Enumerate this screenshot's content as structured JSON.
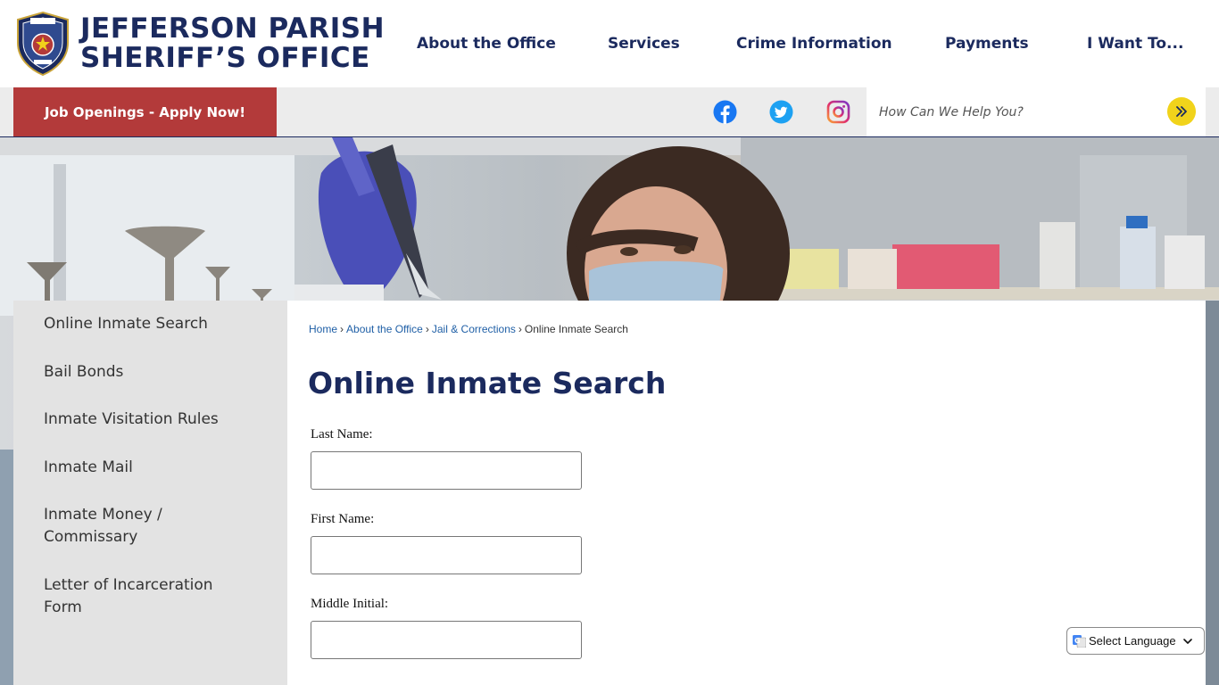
{
  "header": {
    "logo_line1": "JEFFERSON PARISH",
    "logo_line2": "SHERIFF’S OFFICE",
    "badge_icon": "sheriff-badge",
    "nav": [
      "About the Office",
      "Services",
      "Crime Information",
      "Payments",
      "I Want To..."
    ]
  },
  "utility": {
    "job_button": "Job Openings - Apply Now!",
    "social": [
      "facebook-icon",
      "twitter-icon",
      "instagram-icon"
    ],
    "search_placeholder": "How Can We Help You?"
  },
  "sidebar": {
    "items": [
      "Online Inmate Search",
      "Bail Bonds",
      "Inmate Visitation Rules",
      "Inmate Mail",
      "Inmate Money / Commissary",
      "Letter of Incarceration Form"
    ]
  },
  "breadcrumb": {
    "items": [
      "Home",
      "About the Office",
      "Jail & Corrections"
    ],
    "current": "Online Inmate Search",
    "separator": "›"
  },
  "main": {
    "title": "Online Inmate Search",
    "fields": [
      {
        "label": "Last Name:",
        "value": ""
      },
      {
        "label": "First Name:",
        "value": ""
      },
      {
        "label": "Middle Initial:",
        "value": ""
      }
    ]
  },
  "translate": {
    "label": "Select Language"
  },
  "colors": {
    "brand_navy": "#1b2a5e",
    "job_red": "#b33a3a",
    "search_yellow": "#f1d31b",
    "link_blue": "#1f5fa6"
  }
}
